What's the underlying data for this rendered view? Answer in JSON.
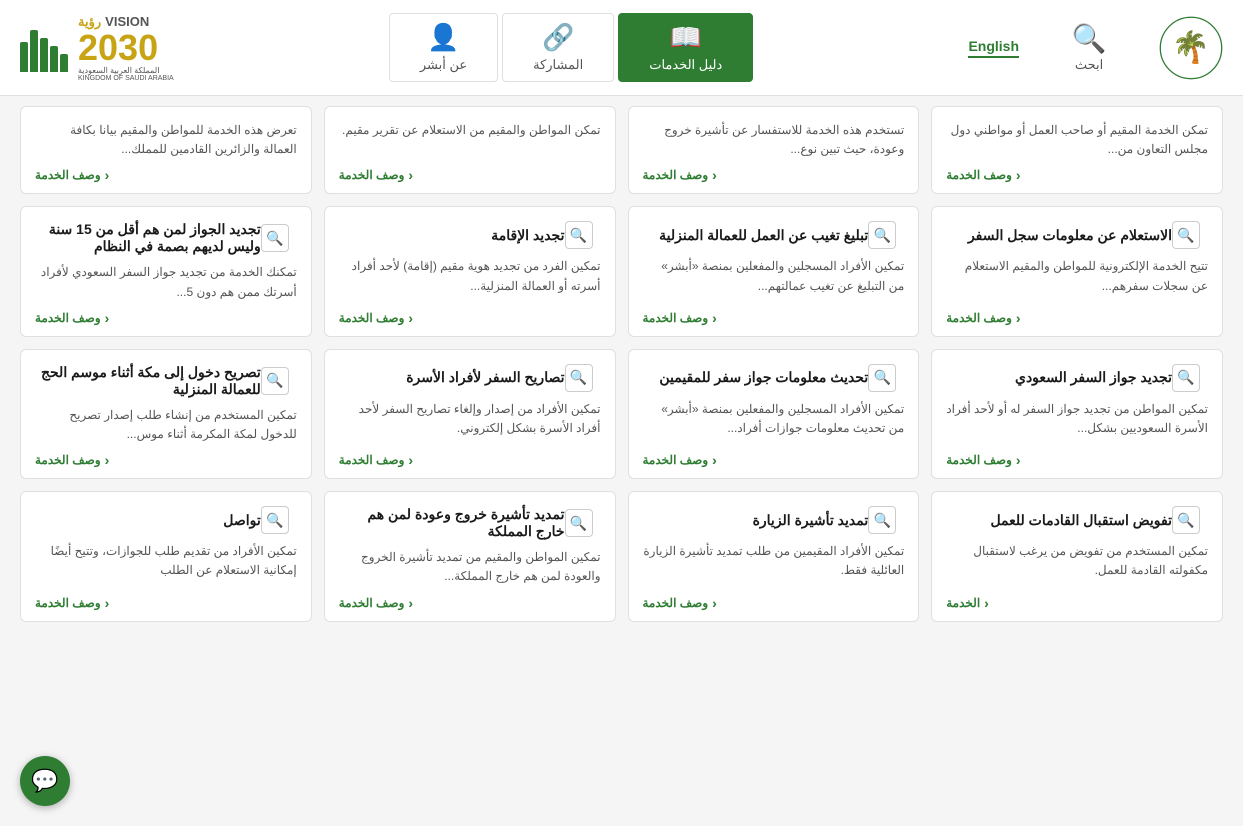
{
  "header": {
    "search_label": "ابحث",
    "english_label": "English",
    "nav_items": [
      {
        "id": "daleel",
        "label": "دليل الخدمات",
        "icon": "📖",
        "active": true
      },
      {
        "id": "musharaka",
        "label": "المشاركة",
        "icon": "🔗",
        "active": false
      },
      {
        "id": "absher",
        "label": "عن أبشر",
        "icon": "👤",
        "active": false
      }
    ],
    "vision_text": "VISION رؤية",
    "vision_year": "2030",
    "vision_country": "المملكة العربية السعودية\nKINGDOM OF SAUDI ARABIA"
  },
  "cards": [
    {
      "id": "c1",
      "title": "الاستعلام عن معلومات سجل السفر",
      "desc": "تتيح الخدمة الإلكترونية للمواطن والمقيم الاستعلام عن سجلات سفرهم...",
      "link": "وصف الخدمة"
    },
    {
      "id": "c2",
      "title": "تبليغ تغيب عن العمل للعمالة المنزلية",
      "desc": "تمكين الأفراد المسجلين والمفعلين بمنصة «أبشر» من التبليغ عن تغيب عمالتهم...",
      "link": "وصف الخدمة"
    },
    {
      "id": "c3",
      "title": "تجديد الإقامة",
      "desc": "تمكين الفرد من تجديد هوية مقيم (إقامة) لأحد أفراد أسرته أو العمالة المنزلية...",
      "link": "وصف الخدمة"
    },
    {
      "id": "c4",
      "title": "تجديد الجواز لمن هم أقل من 15 سنة وليس لديهم بصمة في النظام",
      "desc": "تمكنك الخدمة من تجديد جواز السفر السعودي لأفراد أسرتك ممن هم دون 5...",
      "link": "وصف الخدمة"
    },
    {
      "id": "c5",
      "title": "تجديد جواز السفر السعودي",
      "desc": "تمكين المواطن من تجديد جواز السفر له أو لأحد أفراد الأسرة السعوديين بشكل...",
      "link": "وصف الخدمة"
    },
    {
      "id": "c6",
      "title": "تحديث معلومات جواز سفر للمقيمين",
      "desc": "تمكين الأفراد المسجلين والمفعلين بمنصة «أبشر» من تحديث معلومات جوازات أفراد...",
      "link": "وصف الخدمة"
    },
    {
      "id": "c7",
      "title": "تصاريح السفر لأفراد الأسرة",
      "desc": "تمكين الأفراد من إصدار وإلغاء تصاريح السفر لأحد أفراد الأسرة بشكل إلكتروني.",
      "link": "وصف الخدمة"
    },
    {
      "id": "c8",
      "title": "تصريح دخول إلى مكة أثناء موسم الحج للعمالة المنزلية",
      "desc": "تمكين المستخدم من إنشاء طلب إصدار تصريح للدخول لمكة المكرمة أثناء موس...",
      "link": "وصف الخدمة"
    },
    {
      "id": "c9",
      "title": "تفويض استقبال القادمات للعمل",
      "desc": "تمكين المستخدم من تفويض من يرغب لاستقبال مكفولته القادمة للعمل.",
      "link": "الخدمة"
    },
    {
      "id": "c10",
      "title": "تمديد تأشيرة الزيارة",
      "desc": "تمكين الأفراد المقيمين من طلب تمديد تأشيرة الزيارة العائلية فقط.",
      "link": "وصف الخدمة"
    },
    {
      "id": "c11",
      "title": "تمديد تأشيرة خروج وعودة لمن هم خارج المملكة",
      "desc": "تمكين المواطن والمقيم من تمديد تأشيرة الخروج والعودة لمن هم خارج المملكة...",
      "link": "وصف الخدمة"
    },
    {
      "id": "c12",
      "title": "تواصل",
      "desc": "تمكين الأفراد من تقديم طلب للجوازات، وتتيح أيضًا إمكانية الاستعلام عن الطلب",
      "link": "وصف الخدمة"
    },
    {
      "id": "c13",
      "title": "",
      "desc": "تعرض هذه الخدمة للمواطن والمقيم بيانا بكافة العمالة والزائرين القادمين للمملك...",
      "link": "وصف الخدمة"
    },
    {
      "id": "c14",
      "title": "",
      "desc": "تمكن المواطن والمقيم من الاستعلام عن تقرير مقيم.",
      "link": "وصف الخدمة"
    },
    {
      "id": "c15",
      "title": "",
      "desc": "تستخدم هذه الخدمة للاستفسار عن تأشيرة خروج وعودة، حيث تبين نوع...",
      "link": "وصف الخدمة"
    },
    {
      "id": "c16",
      "title": "",
      "desc": "تمكن الخدمة المقيم أو صاحب العمل أو مواطني دول مجلس التعاون من...",
      "link": "وصف الخدمة"
    }
  ],
  "fab_icon": "💬"
}
